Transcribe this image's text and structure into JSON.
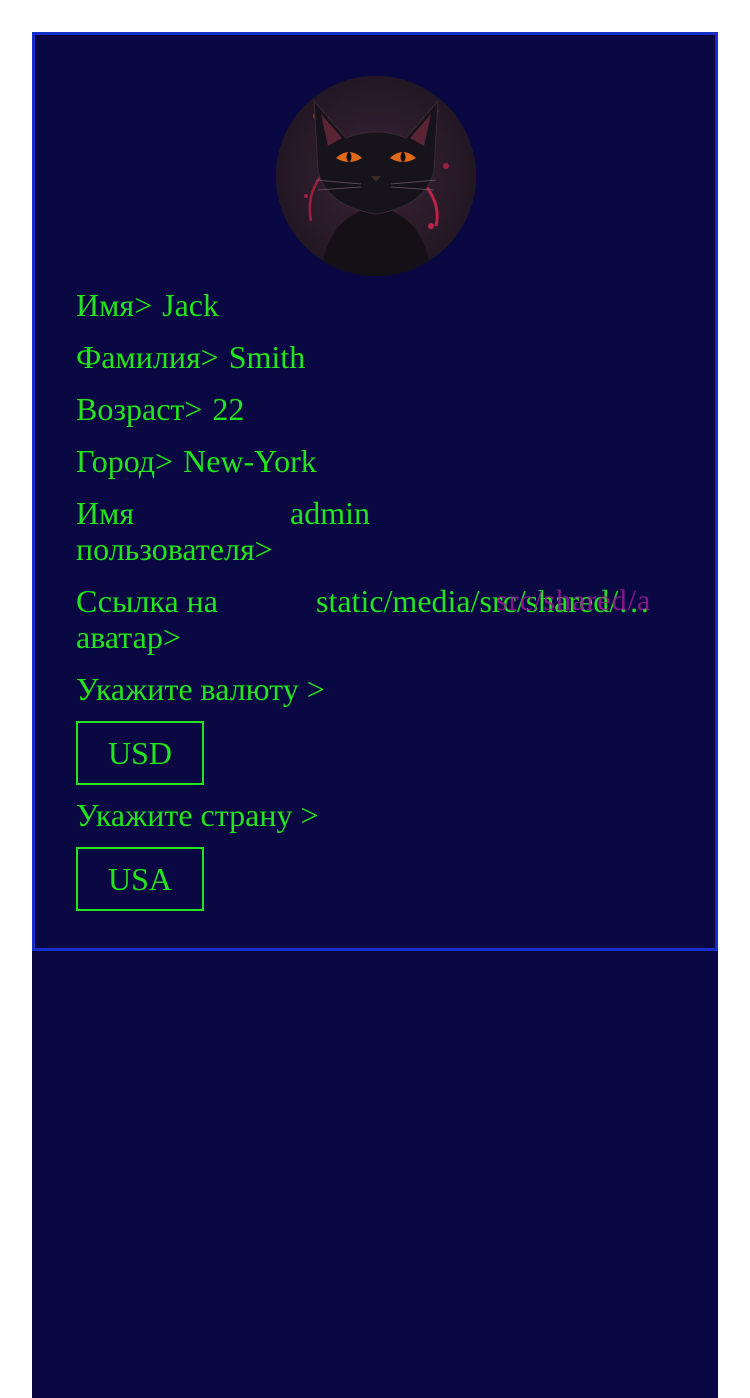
{
  "profile": {
    "first_name_label": "Имя>",
    "first_name": "Jack",
    "last_name_label": "Фамилия>",
    "last_name": "Smith",
    "age_label": "Возраст>",
    "age": "22",
    "city_label": "Город>",
    "city": "New-York",
    "username_label": "Имя пользователя>",
    "username": "admin",
    "avatar_link_label": "Ссылка на аватар>",
    "avatar_link": "static/media/src/shared/a…",
    "avatar_link_overlay": "src/shared/a",
    "currency_label": "Укажите валюту >",
    "currency": "USD",
    "country_label": "Укажите страну >",
    "country": "USA"
  },
  "colors": {
    "background": "#0a0842",
    "border": "#1530c9",
    "text": "#22e51d"
  },
  "icons": {
    "avatar": "black-cat-avatar"
  }
}
